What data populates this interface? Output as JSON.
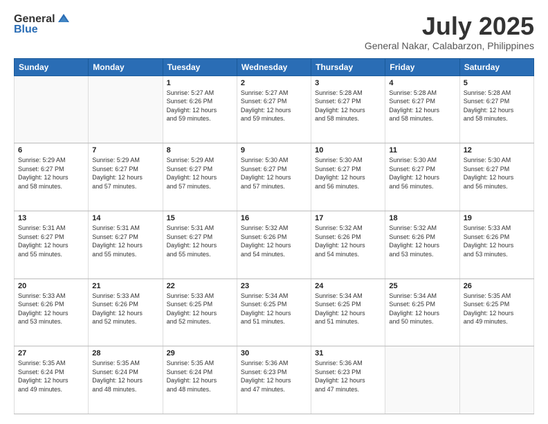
{
  "header": {
    "logo_general": "General",
    "logo_blue": "Blue",
    "title": "July 2025",
    "location": "General Nakar, Calabarzon, Philippines"
  },
  "calendar": {
    "days_of_week": [
      "Sunday",
      "Monday",
      "Tuesday",
      "Wednesday",
      "Thursday",
      "Friday",
      "Saturday"
    ],
    "weeks": [
      [
        {
          "day": "",
          "info": ""
        },
        {
          "day": "",
          "info": ""
        },
        {
          "day": "1",
          "info": "Sunrise: 5:27 AM\nSunset: 6:26 PM\nDaylight: 12 hours\nand 59 minutes."
        },
        {
          "day": "2",
          "info": "Sunrise: 5:27 AM\nSunset: 6:27 PM\nDaylight: 12 hours\nand 59 minutes."
        },
        {
          "day": "3",
          "info": "Sunrise: 5:28 AM\nSunset: 6:27 PM\nDaylight: 12 hours\nand 58 minutes."
        },
        {
          "day": "4",
          "info": "Sunrise: 5:28 AM\nSunset: 6:27 PM\nDaylight: 12 hours\nand 58 minutes."
        },
        {
          "day": "5",
          "info": "Sunrise: 5:28 AM\nSunset: 6:27 PM\nDaylight: 12 hours\nand 58 minutes."
        }
      ],
      [
        {
          "day": "6",
          "info": "Sunrise: 5:29 AM\nSunset: 6:27 PM\nDaylight: 12 hours\nand 58 minutes."
        },
        {
          "day": "7",
          "info": "Sunrise: 5:29 AM\nSunset: 6:27 PM\nDaylight: 12 hours\nand 57 minutes."
        },
        {
          "day": "8",
          "info": "Sunrise: 5:29 AM\nSunset: 6:27 PM\nDaylight: 12 hours\nand 57 minutes."
        },
        {
          "day": "9",
          "info": "Sunrise: 5:30 AM\nSunset: 6:27 PM\nDaylight: 12 hours\nand 57 minutes."
        },
        {
          "day": "10",
          "info": "Sunrise: 5:30 AM\nSunset: 6:27 PM\nDaylight: 12 hours\nand 56 minutes."
        },
        {
          "day": "11",
          "info": "Sunrise: 5:30 AM\nSunset: 6:27 PM\nDaylight: 12 hours\nand 56 minutes."
        },
        {
          "day": "12",
          "info": "Sunrise: 5:30 AM\nSunset: 6:27 PM\nDaylight: 12 hours\nand 56 minutes."
        }
      ],
      [
        {
          "day": "13",
          "info": "Sunrise: 5:31 AM\nSunset: 6:27 PM\nDaylight: 12 hours\nand 55 minutes."
        },
        {
          "day": "14",
          "info": "Sunrise: 5:31 AM\nSunset: 6:27 PM\nDaylight: 12 hours\nand 55 minutes."
        },
        {
          "day": "15",
          "info": "Sunrise: 5:31 AM\nSunset: 6:27 PM\nDaylight: 12 hours\nand 55 minutes."
        },
        {
          "day": "16",
          "info": "Sunrise: 5:32 AM\nSunset: 6:26 PM\nDaylight: 12 hours\nand 54 minutes."
        },
        {
          "day": "17",
          "info": "Sunrise: 5:32 AM\nSunset: 6:26 PM\nDaylight: 12 hours\nand 54 minutes."
        },
        {
          "day": "18",
          "info": "Sunrise: 5:32 AM\nSunset: 6:26 PM\nDaylight: 12 hours\nand 53 minutes."
        },
        {
          "day": "19",
          "info": "Sunrise: 5:33 AM\nSunset: 6:26 PM\nDaylight: 12 hours\nand 53 minutes."
        }
      ],
      [
        {
          "day": "20",
          "info": "Sunrise: 5:33 AM\nSunset: 6:26 PM\nDaylight: 12 hours\nand 53 minutes."
        },
        {
          "day": "21",
          "info": "Sunrise: 5:33 AM\nSunset: 6:26 PM\nDaylight: 12 hours\nand 52 minutes."
        },
        {
          "day": "22",
          "info": "Sunrise: 5:33 AM\nSunset: 6:25 PM\nDaylight: 12 hours\nand 52 minutes."
        },
        {
          "day": "23",
          "info": "Sunrise: 5:34 AM\nSunset: 6:25 PM\nDaylight: 12 hours\nand 51 minutes."
        },
        {
          "day": "24",
          "info": "Sunrise: 5:34 AM\nSunset: 6:25 PM\nDaylight: 12 hours\nand 51 minutes."
        },
        {
          "day": "25",
          "info": "Sunrise: 5:34 AM\nSunset: 6:25 PM\nDaylight: 12 hours\nand 50 minutes."
        },
        {
          "day": "26",
          "info": "Sunrise: 5:35 AM\nSunset: 6:25 PM\nDaylight: 12 hours\nand 49 minutes."
        }
      ],
      [
        {
          "day": "27",
          "info": "Sunrise: 5:35 AM\nSunset: 6:24 PM\nDaylight: 12 hours\nand 49 minutes."
        },
        {
          "day": "28",
          "info": "Sunrise: 5:35 AM\nSunset: 6:24 PM\nDaylight: 12 hours\nand 48 minutes."
        },
        {
          "day": "29",
          "info": "Sunrise: 5:35 AM\nSunset: 6:24 PM\nDaylight: 12 hours\nand 48 minutes."
        },
        {
          "day": "30",
          "info": "Sunrise: 5:36 AM\nSunset: 6:23 PM\nDaylight: 12 hours\nand 47 minutes."
        },
        {
          "day": "31",
          "info": "Sunrise: 5:36 AM\nSunset: 6:23 PM\nDaylight: 12 hours\nand 47 minutes."
        },
        {
          "day": "",
          "info": ""
        },
        {
          "day": "",
          "info": ""
        }
      ]
    ]
  }
}
